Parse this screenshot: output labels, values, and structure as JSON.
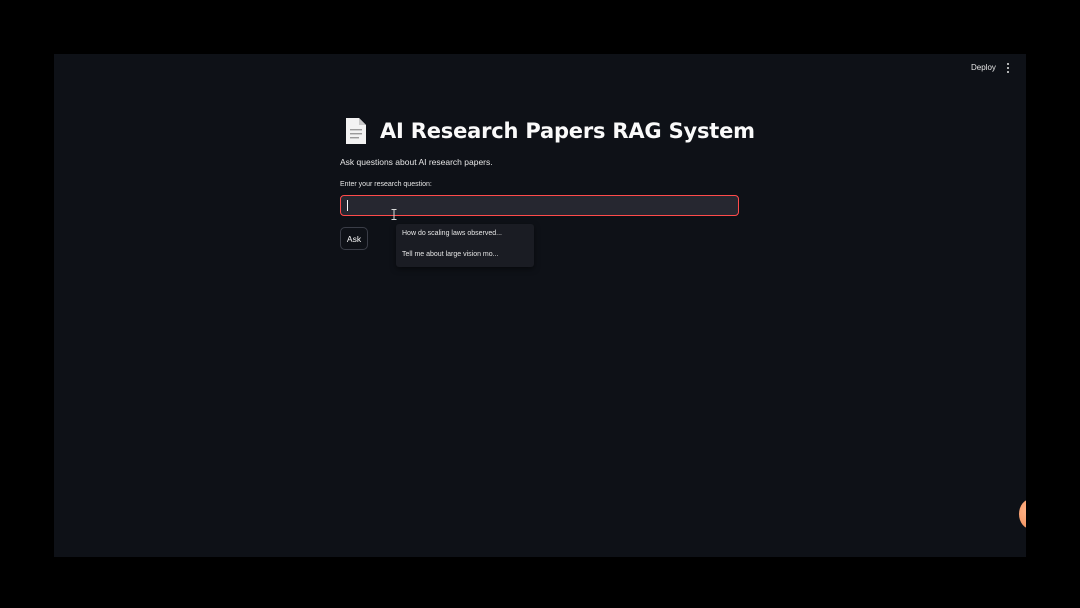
{
  "topbar": {
    "deploy_label": "Deploy",
    "menu_icon": "more-vertical-icon"
  },
  "header": {
    "icon": "document-icon",
    "title": "AI Research Papers RAG System",
    "subtitle": "Ask questions about AI research papers."
  },
  "form": {
    "question_label": "Enter your research question:",
    "question_value": "",
    "ask_label": "Ask"
  },
  "autocomplete": {
    "suggestions": [
      "How do scaling laws observed...",
      "Tell me about large vision mo..."
    ]
  },
  "colors": {
    "background": "#0e1117",
    "input_background": "#262730",
    "focus_border": "#ff4b4b",
    "text": "#fafafa"
  }
}
